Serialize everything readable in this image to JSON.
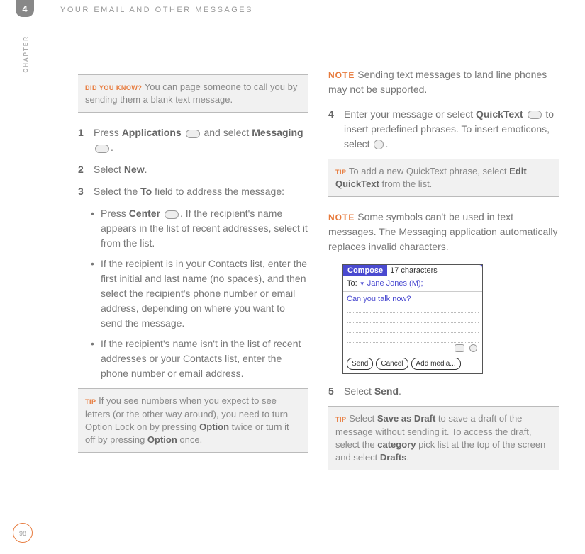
{
  "chapter_number": "4",
  "chapter_word": "CHAPTER",
  "header_title": "YOUR EMAIL AND OTHER MESSAGES",
  "page_number": "98",
  "didyouknow": {
    "label": "DID YOU KNOW?",
    "text": "You can page someone to call you by sending them a blank text message."
  },
  "steps_left": {
    "s1_a": "Press ",
    "s1_b": "Applications",
    "s1_c": " and select ",
    "s1_d": "Messaging",
    "s1_e": ".",
    "s2_a": "Select ",
    "s2_b": "New",
    "s2_c": ".",
    "s3_a": "Select the ",
    "s3_b": "To",
    "s3_c": " field to address the message:",
    "b1_a": "Press ",
    "b1_b": "Center",
    "b1_c": ". If the recipient's name appears in the list of recent addresses, select it from the list.",
    "b2": "If the recipient is in your Contacts list, enter the first initial and last name (no spaces), and then select the recipient's phone number or email address, depending on where you want to send the message.",
    "b3": "If the recipient's name isn't in the list of recent addresses or your Contacts list, enter the phone number or email address."
  },
  "tip1": {
    "label": "TIP",
    "t1": "If you see numbers when you expect to see letters (or the other way around), you need to turn Option Lock on by pressing ",
    "t2": "Option",
    "t3": " twice or turn it off by pressing ",
    "t4": "Option",
    "t5": " once."
  },
  "right": {
    "note1_label": "NOTE",
    "note1": "Sending text messages to land line phones may not be supported.",
    "s4_a": "Enter your message or select ",
    "s4_b": "QuickText",
    "s4_c": " to insert predefined phrases. To insert emoticons, select ",
    "s4_d": ".",
    "tip2_label": "TIP",
    "tip2_a": "To add a new QuickText phrase, select ",
    "tip2_b": "Edit QuickText",
    "tip2_c": " from the list.",
    "note2_label": "NOTE",
    "note2": "Some symbols can't be used in text messages. The Messaging application automatically replaces invalid characters.",
    "s5_a": "Select ",
    "s5_b": "Send",
    "s5_c": ".",
    "tip3_label": "TIP",
    "tip3_a": "Select ",
    "tip3_b": "Save as Draft",
    "tip3_c": " to save a draft of the message without sending it. To access the draft, select the ",
    "tip3_d": "category",
    "tip3_e": " pick list at the top of the screen and select ",
    "tip3_f": "Drafts",
    "tip3_g": "."
  },
  "compose": {
    "title": "Compose",
    "counter": "17 characters",
    "to_label": "To:",
    "to_name": "Jane Jones (M);",
    "body_line": "Can you talk now?",
    "btn_send": "Send",
    "btn_cancel": "Cancel",
    "btn_add": "Add media..."
  }
}
